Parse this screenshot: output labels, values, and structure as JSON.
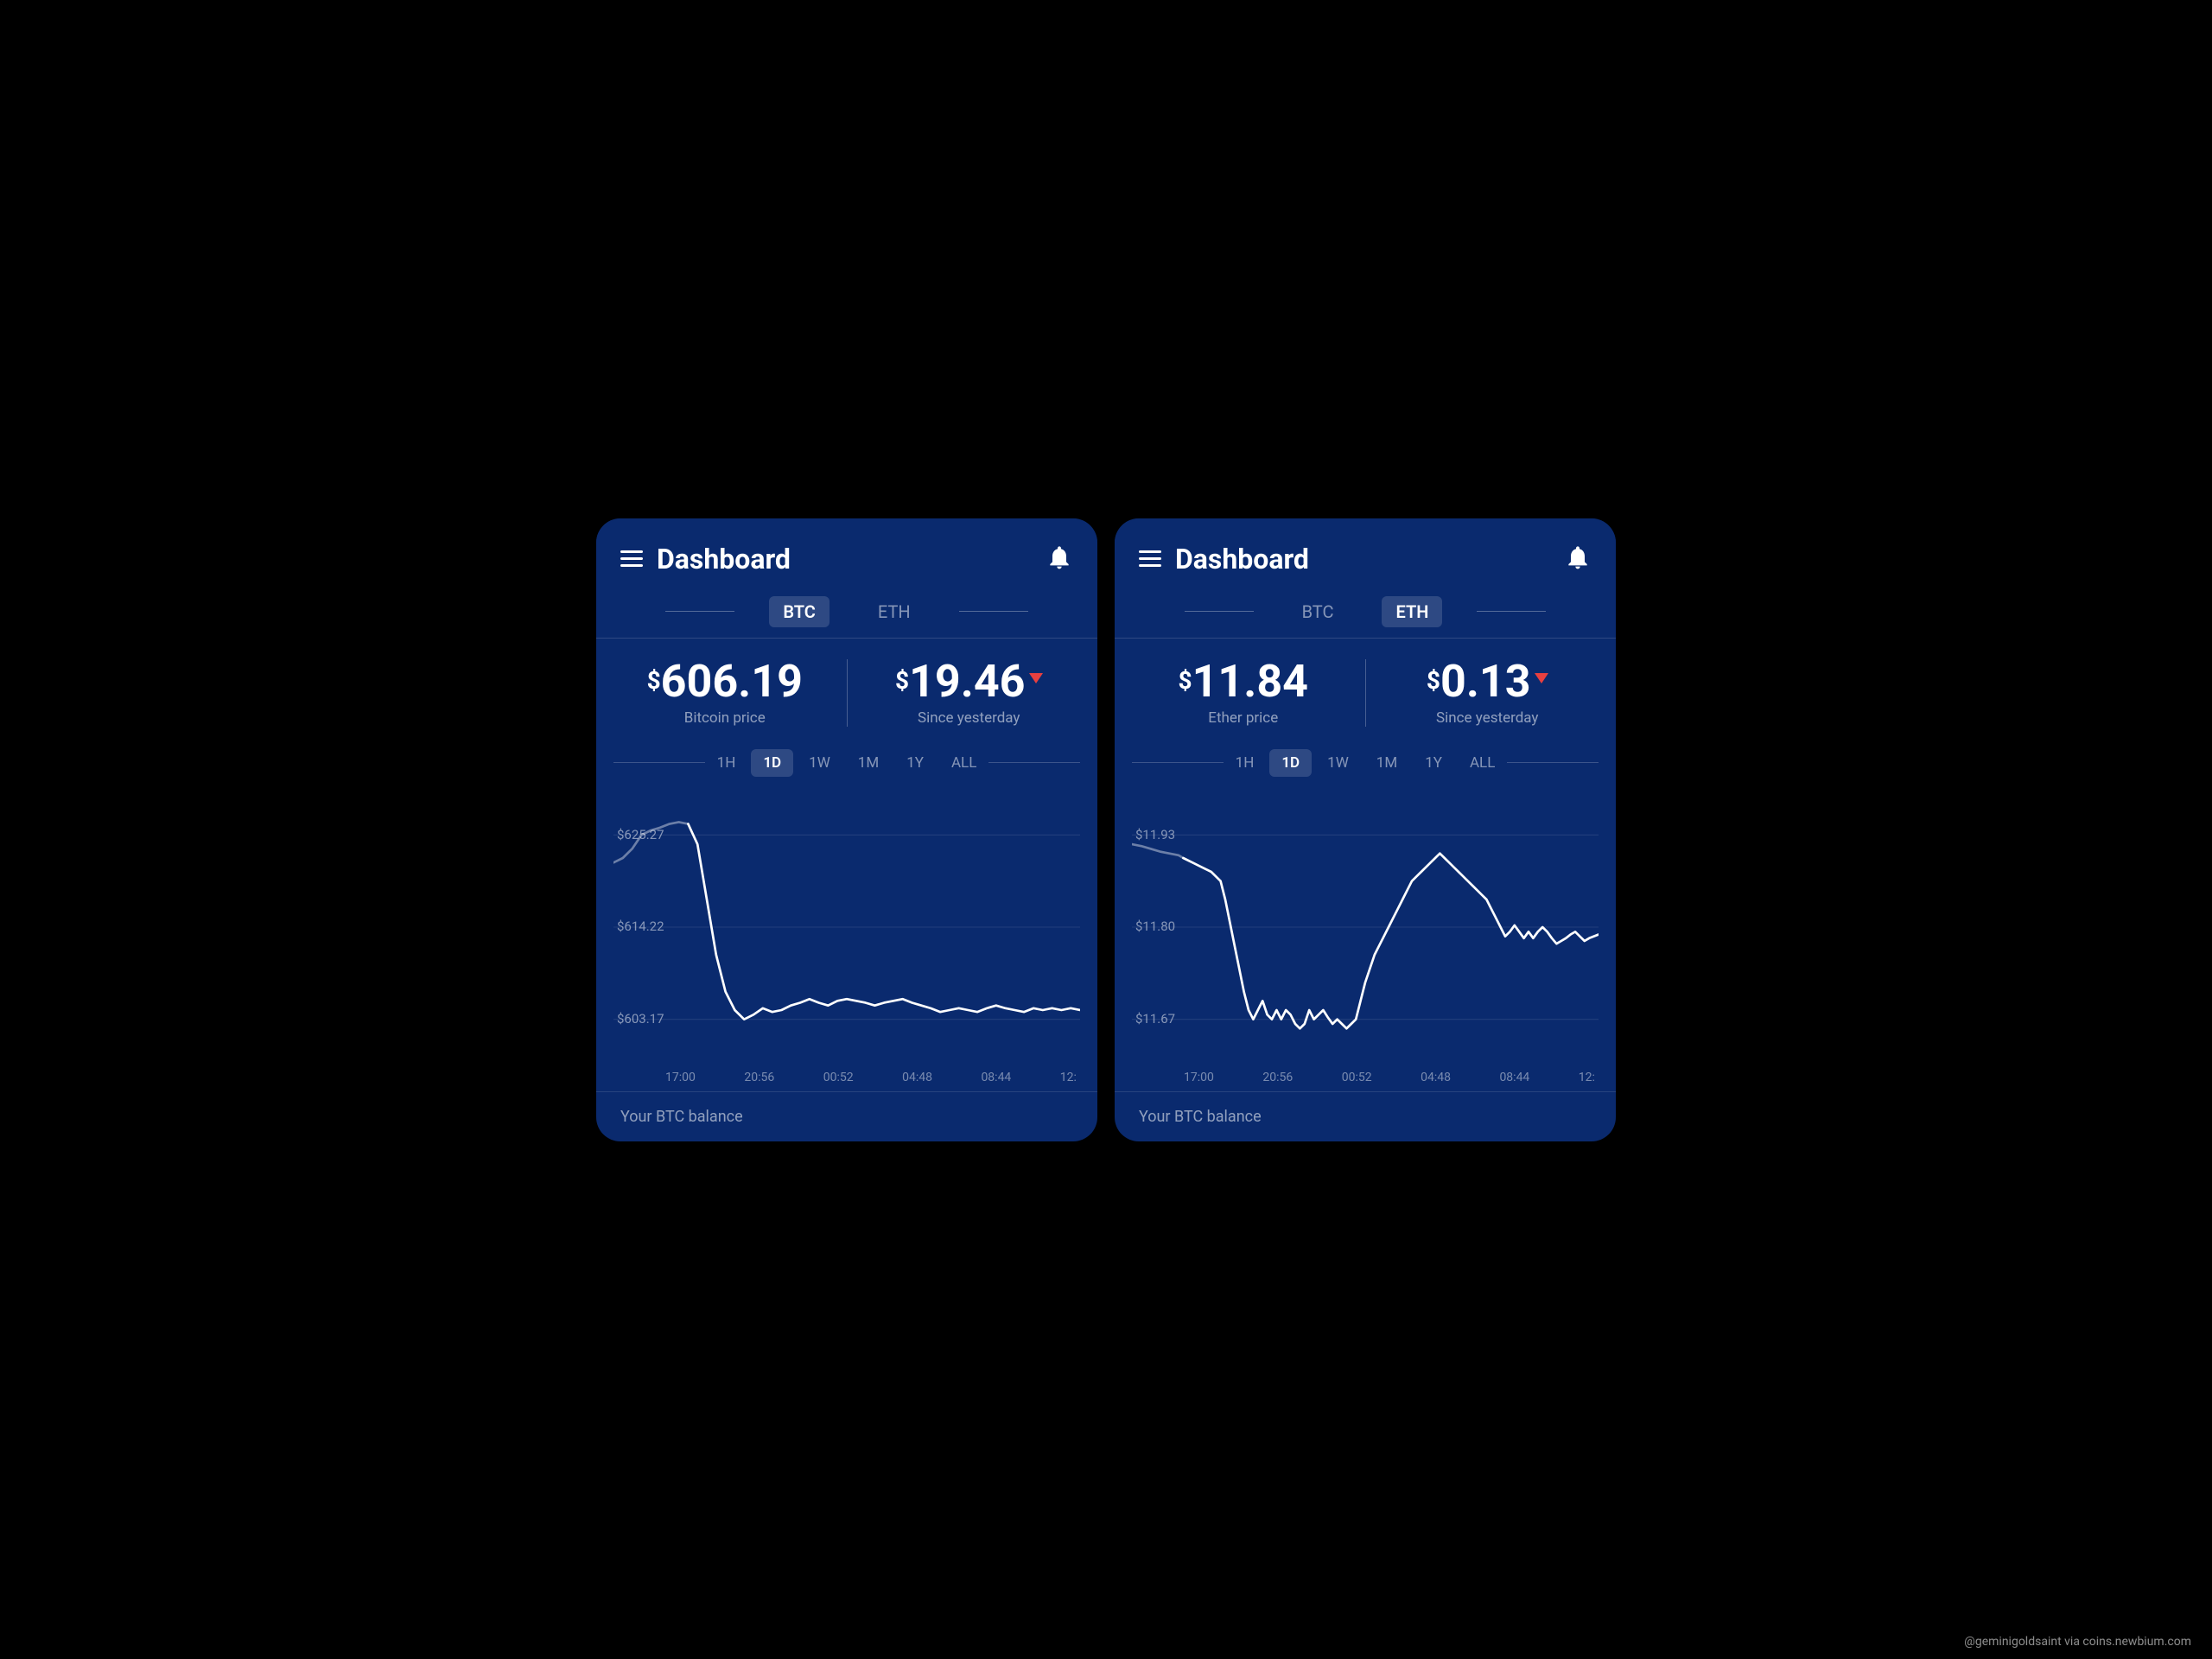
{
  "panel_left": {
    "title": "Dashboard",
    "tabs": [
      "BTC",
      "ETH"
    ],
    "active_tab": "BTC",
    "has_arrow": true,
    "price": {
      "main_value": "606.19",
      "main_label": "Bitcoin price",
      "change_value": "19.46",
      "change_label": "Since yesterday",
      "change_direction": "down"
    },
    "timeframes": [
      "1H",
      "1D",
      "1W",
      "1M",
      "1Y",
      "ALL"
    ],
    "active_timeframe": "1D",
    "chart": {
      "y_labels": [
        "$625.27",
        "$614.22",
        "$603.17"
      ],
      "x_labels": [
        "17:00",
        "20:56",
        "00:52",
        "04:48",
        "08:44",
        "12:"
      ]
    },
    "footer": "Your BTC balance"
  },
  "panel_right": {
    "title": "Dashboard",
    "tabs": [
      "BTC",
      "ETH"
    ],
    "active_tab": "ETH",
    "has_arrow": false,
    "price": {
      "main_value": "11.84",
      "main_label": "Ether price",
      "change_value": "0.13",
      "change_label": "Since yesterday",
      "change_direction": "down"
    },
    "timeframes": [
      "1H",
      "1D",
      "1W",
      "1M",
      "1Y",
      "ALL"
    ],
    "active_timeframe": "1D",
    "chart": {
      "y_labels": [
        "$11.93",
        "$11.80",
        "$11.67"
      ],
      "x_labels": [
        "17:00",
        "20:56",
        "00:52",
        "04:48",
        "08:44",
        "12:"
      ]
    },
    "footer": "Your BTC balance"
  },
  "watermark": "@geminigoldsaint via coins.newbium.com",
  "icons": {
    "hamburger": "☰",
    "bell": "🔔"
  }
}
